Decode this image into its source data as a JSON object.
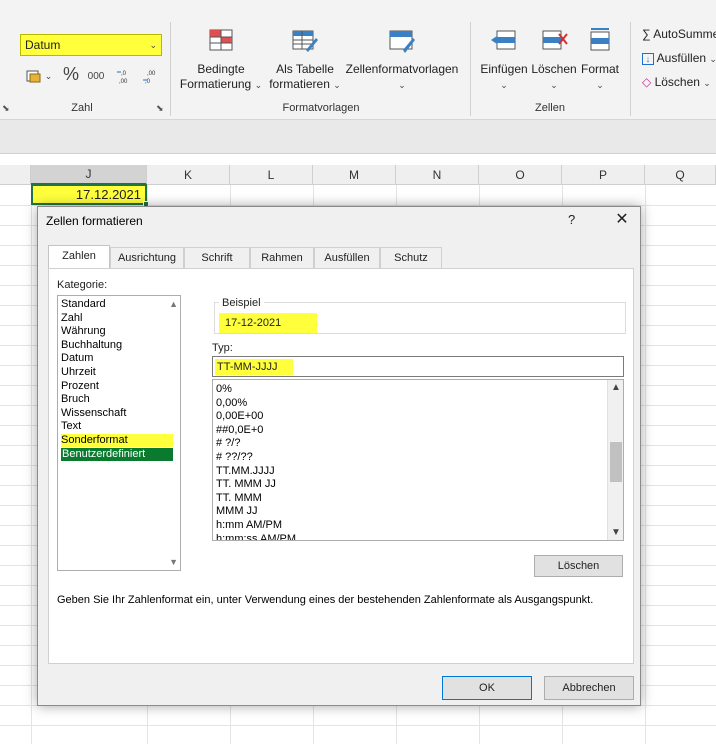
{
  "ribbon": {
    "number_format_value": "Datum",
    "group_number": "Zahl",
    "group_styles": "Formatvorlagen",
    "group_cells": "Zellen",
    "cond_format_l1": "Bedingte",
    "cond_format_l2": "Formatierung",
    "as_table_l1": "Als Tabelle",
    "as_table_l2": "formatieren",
    "cell_styles": "Zellenformatvorlagen",
    "insert": "Einfügen",
    "delete": "Löschen",
    "format": "Format",
    "autosum": "AutoSumme",
    "fill": "Ausfüllen",
    "clear": "Löschen",
    "percent_symbol": "%",
    "thousands": "000"
  },
  "sheet": {
    "columns": [
      "J",
      "K",
      "L",
      "M",
      "N",
      "O",
      "P",
      "Q"
    ],
    "selected_column": "J",
    "cell_value": "17.12.2021"
  },
  "dialog": {
    "title": "Zellen formatieren",
    "help": "?",
    "close": "✕",
    "tabs": [
      "Zahlen",
      "Ausrichtung",
      "Schrift",
      "Rahmen",
      "Ausfüllen",
      "Schutz"
    ],
    "active_tab": "Zahlen",
    "category_label": "Kategorie:",
    "categories": [
      "Standard",
      "Zahl",
      "Währung",
      "Buchhaltung",
      "Datum",
      "Uhrzeit",
      "Prozent",
      "Bruch",
      "Wissenschaft",
      "Text",
      "Sonderformat",
      "Benutzerdefiniert"
    ],
    "selected_category": "Benutzerdefiniert",
    "sample_label": "Beispiel",
    "sample_value": "17-12-2021",
    "type_label": "Typ:",
    "type_value": "TT-MM-JJJJ",
    "formats": [
      "0%",
      "0,00%",
      "0,00E+00",
      "##0,0E+0",
      "# ?/?",
      "# ??/??",
      "TT.MM.JJJJ",
      "TT. MMM JJ",
      "TT. MMM",
      "MMM JJ",
      "h:mm AM/PM",
      "h:mm:ss AM/PM"
    ],
    "delete_button": "Löschen",
    "hint": "Geben Sie Ihr Zahlenformat ein, unter Verwendung eines der bestehenden Zahlenformate als Ausgangspunkt.",
    "ok_button": "OK",
    "cancel_button": "Abbrechen"
  },
  "colors": {
    "highlight": "#ffff3c",
    "excel_green": "#217346",
    "selected_category_bg": "#0a7a2f"
  }
}
